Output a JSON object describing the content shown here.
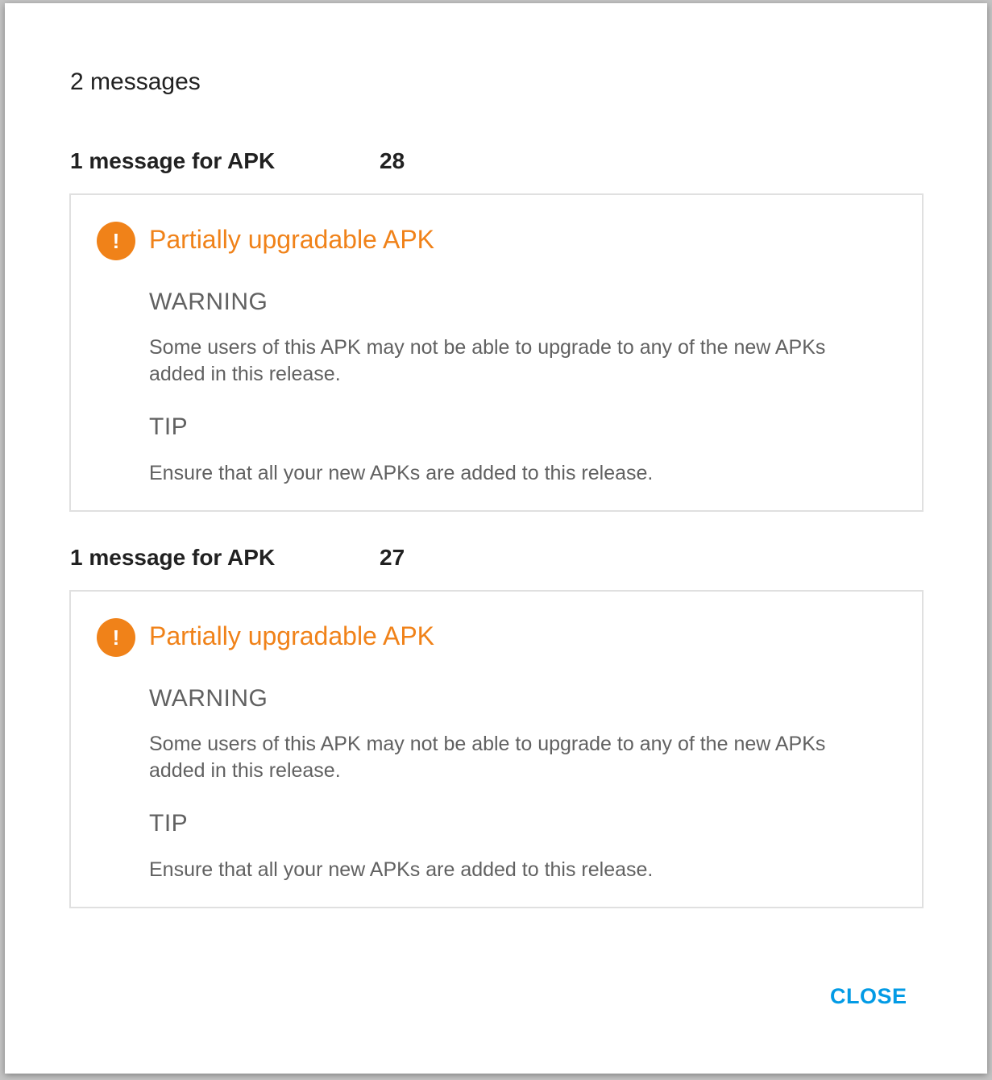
{
  "dialog": {
    "title": "2 messages",
    "close_label": "CLOSE"
  },
  "groups": [
    {
      "heading": "1 message for APK",
      "version_code": "28",
      "message": {
        "title": "Partially upgradable APK",
        "icon": "warning-circle-icon",
        "warning_label": "WARNING",
        "warning_text": "Some users of this APK may not be able to upgrade to any of the new APKs added in this release.",
        "tip_label": "TIP",
        "tip_text": "Ensure that all your new APKs are added to this release."
      }
    },
    {
      "heading": "1 message for APK",
      "version_code": "27",
      "message": {
        "title": "Partially upgradable APK",
        "icon": "warning-circle-icon",
        "warning_label": "WARNING",
        "warning_text": "Some users of this APK may not be able to upgrade to any of the new APKs added in this release.",
        "tip_label": "TIP",
        "tip_text": "Ensure that all your new APKs are added to this release."
      }
    }
  ],
  "colors": {
    "warning": "#f08219",
    "accent": "#039be5",
    "text_primary": "#212121",
    "text_secondary": "#616161"
  }
}
